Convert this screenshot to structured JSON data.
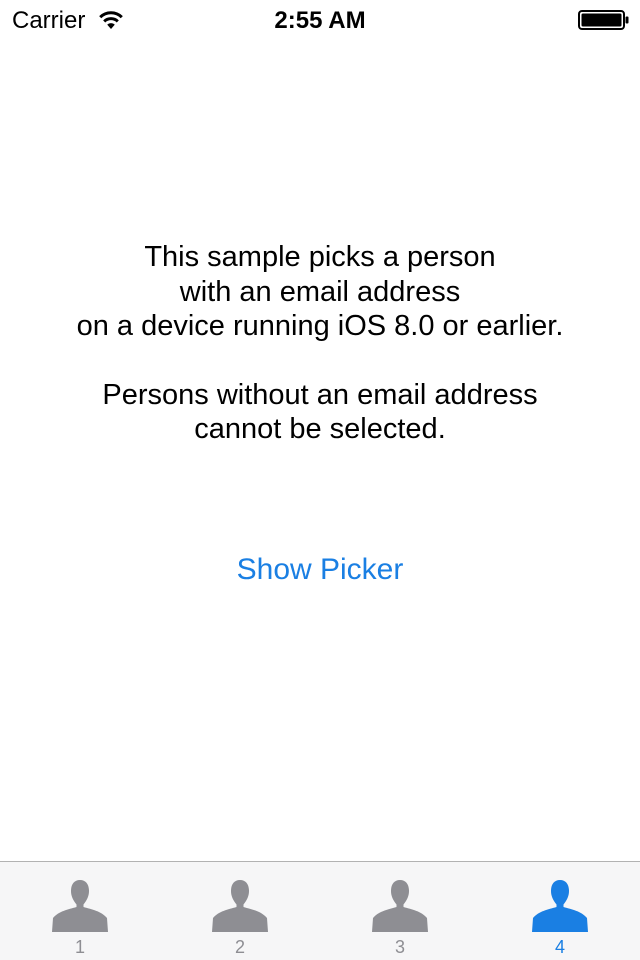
{
  "status_bar": {
    "carrier": "Carrier",
    "time": "2:55 AM",
    "wifi_icon": "wifi-icon",
    "battery_icon": "battery-icon"
  },
  "main": {
    "instruction_lines_1": [
      "This sample picks a person",
      "with an email address",
      "on a device running iOS 8.0 or earlier."
    ],
    "instruction_lines_2": [
      "Persons without an email address",
      "cannot be selected."
    ],
    "show_picker_label": "Show Picker"
  },
  "tab_bar": {
    "tabs": [
      {
        "label": "1",
        "icon": "person-icon",
        "selected": false
      },
      {
        "label": "2",
        "icon": "person-icon",
        "selected": false
      },
      {
        "label": "3",
        "icon": "person-icon",
        "selected": false
      },
      {
        "label": "4",
        "icon": "person-icon",
        "selected": true
      }
    ]
  },
  "colors": {
    "accent": "#1a7fe3",
    "tab_inactive": "#8e8e93",
    "tab_bar_background": "#f6f6f7"
  }
}
